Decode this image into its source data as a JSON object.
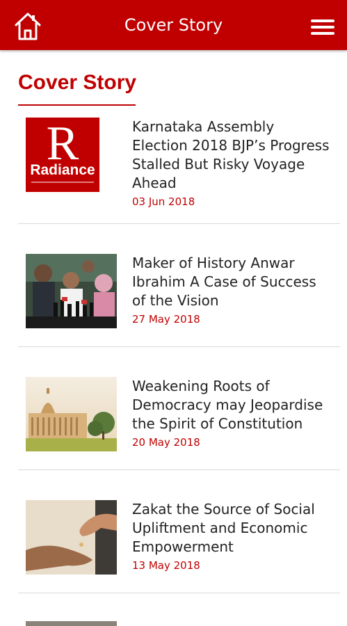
{
  "appbar": {
    "title": "Cover Story",
    "home_icon": "home-icon",
    "menu_icon": "hamburger-menu-icon",
    "color": "#c00000"
  },
  "section": {
    "title": "Cover Story"
  },
  "articles": [
    {
      "title": "Karnataka Assembly Election 2018 BJP’s Progress Stalled But Risky Voyage Ahead",
      "date": "03 Jun 2018",
      "thumb_letter": "R",
      "thumb_word": "Radiance"
    },
    {
      "title": "Maker of History Anwar Ibrahim A Case of Success of the Vision",
      "date": "27 May 2018"
    },
    {
      "title": "Weakening Roots of Democracy may Jeopardise the Spirit of Constitution",
      "date": "20 May 2018"
    },
    {
      "title": "Zakat the Source of Social Upliftment and Economic Empowerment",
      "date": "13 May 2018"
    }
  ]
}
